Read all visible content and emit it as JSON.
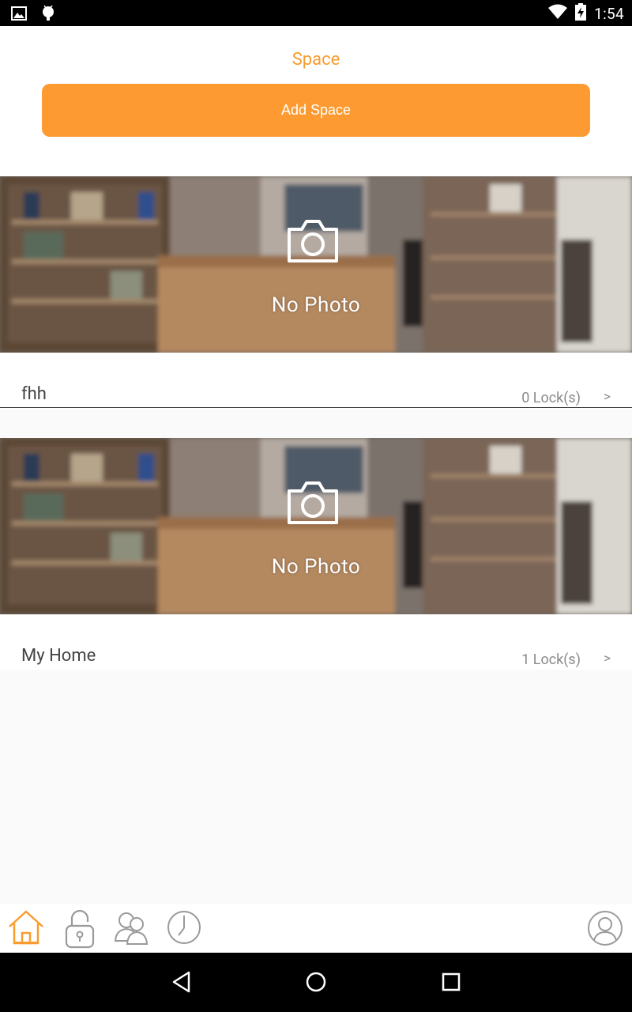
{
  "status_bar": {
    "time": "1:54",
    "left_icons": [
      "image-icon",
      "android-debug-icon"
    ],
    "right_icons": [
      "wifi-icon",
      "battery-charging-icon"
    ]
  },
  "header": {
    "title": "Space",
    "add_button_label": "Add Space"
  },
  "spaces": [
    {
      "name": "fhh",
      "lock_count": "0 Lock(s)",
      "photo_label": "No Photo",
      "chevron": ">"
    },
    {
      "name": "My Home",
      "lock_count": "1 Lock(s)",
      "photo_label": "No Photo",
      "chevron": ">"
    }
  ],
  "tab_bar": {
    "tabs": [
      "home-icon",
      "lock-icon",
      "users-icon",
      "history-clock-icon"
    ],
    "profile": "profile-icon",
    "active_tab": "home-icon"
  },
  "nav_bar": [
    "back-icon",
    "home-circle-icon",
    "recents-icon"
  ],
  "colors": {
    "accent": "#f89c30",
    "button": "#fd9a31",
    "tab_inactive": "#9a9a9a",
    "status_bar": "#000000"
  }
}
